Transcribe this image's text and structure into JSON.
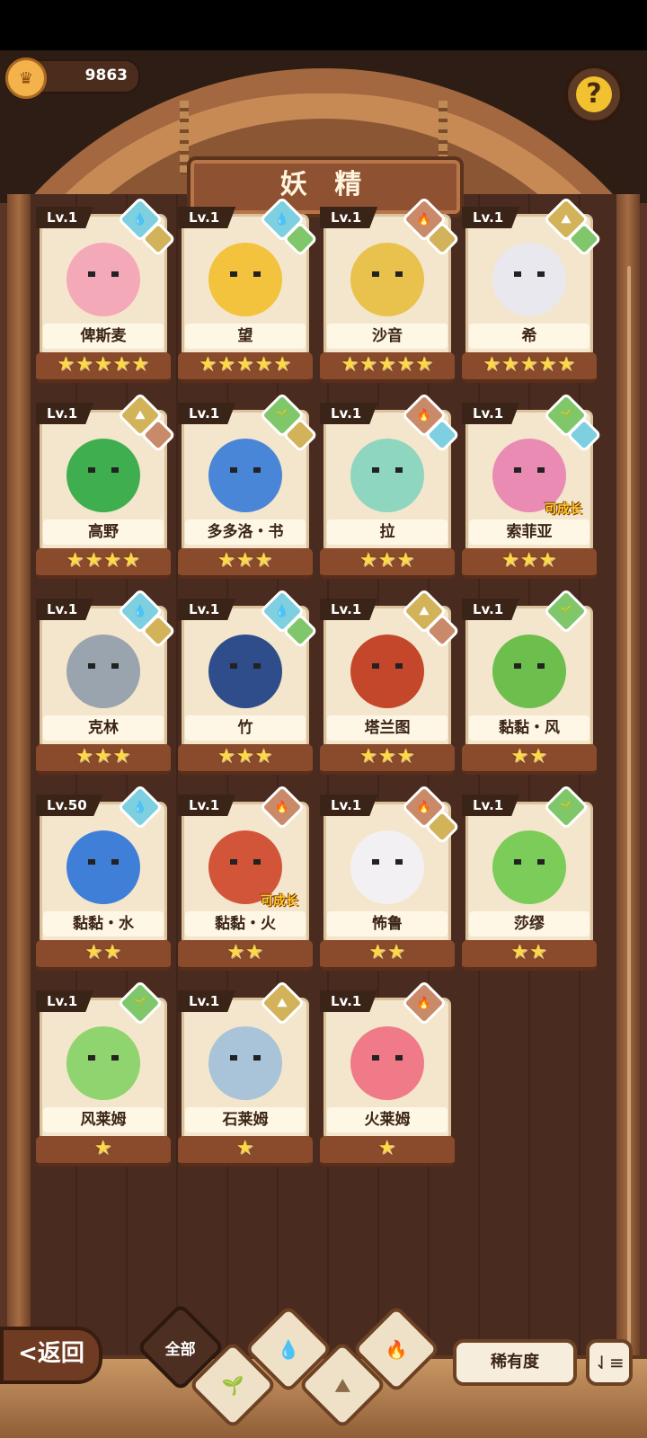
{
  "currency": {
    "value": "9863",
    "icon": "gold-coin-icon"
  },
  "title": "妖 精",
  "help_icon": "question-icon",
  "colors": {
    "water": "#7ecfe0",
    "earth": "#d2b35a",
    "fire": "#c98a6a",
    "wind": "#7fc76a",
    "star": "#ffd84a"
  },
  "fairies": [
    {
      "level": "Lv.1",
      "name": "俾斯麦",
      "stars": "★★★★★",
      "stars_count": 5,
      "elements": [
        "water",
        "earth"
      ],
      "growable": "",
      "hair": "#f4a9b8"
    },
    {
      "level": "Lv.1",
      "name": "望",
      "stars": "★★★★★",
      "stars_count": 5,
      "elements": [
        "water",
        "wind"
      ],
      "growable": "",
      "hair": "#f3c33d"
    },
    {
      "level": "Lv.1",
      "name": "沙音",
      "stars": "★★★★★",
      "stars_count": 5,
      "elements": [
        "fire",
        "earth"
      ],
      "growable": "",
      "hair": "#e9c24e"
    },
    {
      "level": "Lv.1",
      "name": "希",
      "stars": "★★★★★",
      "stars_count": 5,
      "elements": [
        "earth",
        "wind"
      ],
      "growable": "",
      "hair": "#e8e8ee"
    },
    {
      "level": "Lv.1",
      "name": "高野",
      "stars": "★★★★",
      "stars_count": 4,
      "elements": [
        "earth",
        "fire"
      ],
      "growable": "",
      "hair": "#3fae4f"
    },
    {
      "level": "Lv.1",
      "name": "多多洛・书",
      "stars": "★★★",
      "stars_count": 3,
      "elements": [
        "wind",
        "earth"
      ],
      "growable": "",
      "hair": "#4a86d8"
    },
    {
      "level": "Lv.1",
      "name": "拉",
      "stars": "★★★",
      "stars_count": 3,
      "elements": [
        "fire",
        "water"
      ],
      "growable": "",
      "hair": "#8ed6c0"
    },
    {
      "level": "Lv.1",
      "name": "索菲亚",
      "stars": "★★★",
      "stars_count": 3,
      "elements": [
        "wind",
        "water"
      ],
      "growable": "可成长",
      "hair": "#e98bb2"
    },
    {
      "level": "Lv.1",
      "name": "克林",
      "stars": "★★★",
      "stars_count": 3,
      "elements": [
        "water",
        "earth"
      ],
      "growable": "",
      "hair": "#9aa4ae"
    },
    {
      "level": "Lv.1",
      "name": "竹",
      "stars": "★★★",
      "stars_count": 3,
      "elements": [
        "water",
        "wind"
      ],
      "growable": "",
      "hair": "#2e4d8a"
    },
    {
      "level": "Lv.1",
      "name": "塔兰图",
      "stars": "★★★",
      "stars_count": 3,
      "elements": [
        "earth",
        "fire"
      ],
      "growable": "",
      "hair": "#c5472b"
    },
    {
      "level": "Lv.1",
      "name": "黏黏・风",
      "stars": "★★",
      "stars_count": 2,
      "elements": [
        "wind"
      ],
      "growable": "",
      "hair": "#6cbf4c"
    },
    {
      "level": "Lv.50",
      "name": "黏黏・水",
      "stars": "★★",
      "stars_count": 2,
      "elements": [
        "water"
      ],
      "growable": "",
      "hair": "#3f7fd8"
    },
    {
      "level": "Lv.1",
      "name": "黏黏・火",
      "stars": "★★",
      "stars_count": 2,
      "elements": [
        "fire"
      ],
      "growable": "可成长",
      "hair": "#d2553a"
    },
    {
      "level": "Lv.1",
      "name": "怖鲁",
      "stars": "★★",
      "stars_count": 2,
      "elements": [
        "fire",
        "earth"
      ],
      "growable": "",
      "hair": "#f3f0f4"
    },
    {
      "level": "Lv.1",
      "name": "莎缪",
      "stars": "★★",
      "stars_count": 2,
      "elements": [
        "wind"
      ],
      "growable": "",
      "hair": "#7ccc5a"
    },
    {
      "level": "Lv.1",
      "name": "风莱姆",
      "stars": "★",
      "stars_count": 1,
      "elements": [
        "wind"
      ],
      "growable": "",
      "hair": "#8fd46e"
    },
    {
      "level": "Lv.1",
      "name": "石莱姆",
      "stars": "★",
      "stars_count": 1,
      "elements": [
        "earth"
      ],
      "growable": "",
      "hair": "#a9c3d8"
    },
    {
      "level": "Lv.1",
      "name": "火莱姆",
      "stars": "★",
      "stars_count": 1,
      "elements": [
        "fire"
      ],
      "growable": "",
      "hair": "#f07a88"
    }
  ],
  "bottom": {
    "back_label": "<返回",
    "filter_all_label": "全部",
    "filters": [
      {
        "name": "water-filter",
        "icon": "💧"
      },
      {
        "name": "wind-filter",
        "icon": "🌱"
      },
      {
        "name": "earth-filter",
        "icon": "⛰"
      },
      {
        "name": "fire-filter",
        "icon": "🔥"
      }
    ],
    "sort_label": "稀有度",
    "order_icon": "sort-order-icon"
  }
}
